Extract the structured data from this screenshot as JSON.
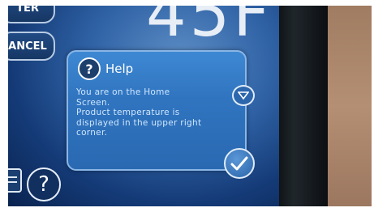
{
  "screen": {
    "temperature_readout": "45F",
    "top_button_label": "TER",
    "cancel_button_label": "ANCEL"
  },
  "dialog": {
    "title": "Help",
    "body_lines": [
      "You are on the Home",
      "Screen.",
      "Product temperature is",
      "displayed in the upper right",
      "corner."
    ]
  },
  "icons": {
    "help": "question-mark-icon",
    "scroll": "triangle-down-icon",
    "confirm": "checkmark-icon",
    "document": "document-icon"
  },
  "colors": {
    "dialog_bg": "#3074bf",
    "dialog_text": "#cfe7ff",
    "screen_bg": "#143a76"
  }
}
